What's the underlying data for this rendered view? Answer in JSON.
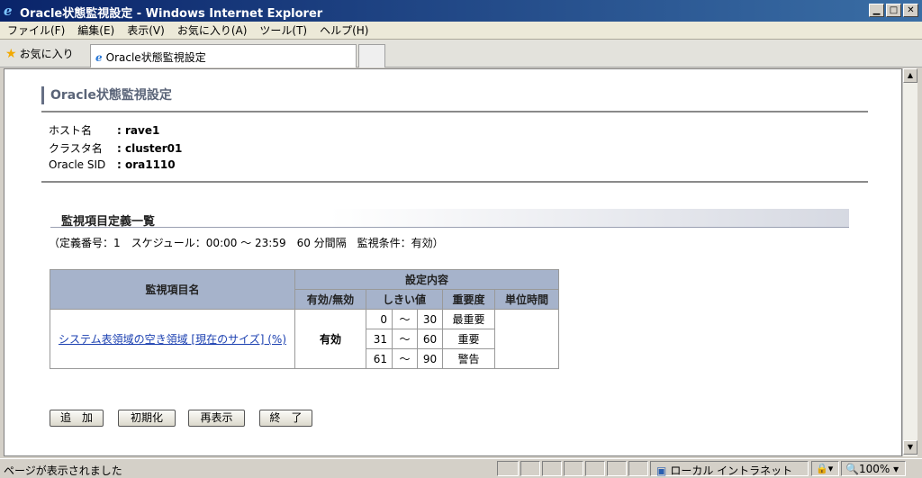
{
  "window": {
    "title": "Oracle状態監視設定 - Windows Internet Explorer"
  },
  "menu": [
    "ファイル(F)",
    "編集(E)",
    "表示(V)",
    "お気に入り(A)",
    "ツール(T)",
    "ヘルプ(H)"
  ],
  "favorites_label": "お気に入り",
  "tab": {
    "title": "Oracle状態監視設定"
  },
  "page": {
    "title": "Oracle状態監視設定",
    "info": [
      {
        "key": "ホスト名",
        "value": ": rave1"
      },
      {
        "key": "クラスタ名",
        "value": ": cluster01"
      },
      {
        "key": "Oracle SID",
        "value": ": ora1110"
      }
    ],
    "section_title": "監視項目定義一覧",
    "summary": "（定義番号：1　スケジュール：00:00 〜 23:59　60 分間隔　監視条件：有効）",
    "table": {
      "headers": {
        "item_name": "監視項目名",
        "settings": "設定内容",
        "enabled": "有効/無効",
        "threshold": "しきい値",
        "severity": "重要度",
        "unit_time": "単位時間"
      },
      "rows": [
        {
          "item": "システム表領域の空き領域 [現在のサイズ] (%)",
          "enabled": "有効",
          "ranges": [
            {
              "from": "0",
              "sep": "〜",
              "to": "30",
              "severity": "最重要"
            },
            {
              "from": "31",
              "sep": "〜",
              "to": "60",
              "severity": "重要"
            },
            {
              "from": "61",
              "sep": "〜",
              "to": "90",
              "severity": "警告"
            }
          ],
          "unit_time": ""
        }
      ]
    },
    "buttons": {
      "add": "追　加",
      "init": "初期化",
      "refresh": "再表示",
      "exit": "終　了"
    }
  },
  "status": {
    "text": "ページが表示されました",
    "zone": "ローカル イントラネット",
    "zoom": "100%"
  }
}
